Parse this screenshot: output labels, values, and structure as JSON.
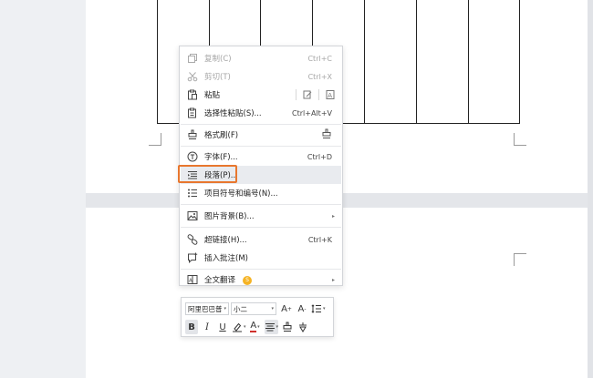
{
  "context_menu": {
    "items": [
      {
        "label": "复制(C)",
        "shortcut": "Ctrl+C",
        "icon": "copy-icon",
        "disabled": true
      },
      {
        "label": "剪切(T)",
        "shortcut": "Ctrl+X",
        "icon": "scissors-icon",
        "disabled": true
      },
      {
        "label": "粘贴",
        "shortcut": "",
        "icon": "paste-icon",
        "disabled": false
      },
      {
        "label": "选择性粘贴(S)...",
        "shortcut": "Ctrl+Alt+V",
        "icon": "paste-special-icon",
        "disabled": false
      },
      {
        "label": "格式刷(F)",
        "shortcut": "",
        "icon": "format-painter-icon",
        "disabled": false
      },
      {
        "label": "字体(F)...",
        "shortcut": "Ctrl+D",
        "icon": "font-icon",
        "disabled": false
      },
      {
        "label": "段落(P)...",
        "shortcut": "",
        "icon": "paragraph-icon",
        "disabled": false
      },
      {
        "label": "项目符号和编号(N)...",
        "shortcut": "",
        "icon": "bullet-list-icon",
        "disabled": false
      },
      {
        "label": "图片背景(B)...",
        "shortcut": "",
        "icon": "picture-icon",
        "disabled": false
      },
      {
        "label": "超链接(H)...",
        "shortcut": "Ctrl+K",
        "icon": "link-icon",
        "disabled": false
      },
      {
        "label": "插入批注(M)",
        "shortcut": "",
        "icon": "comment-icon",
        "disabled": false
      },
      {
        "label": "全文翻译",
        "shortcut": "",
        "icon": "translate-icon",
        "disabled": false
      }
    ],
    "highlight_color": "#e8772e"
  },
  "mini_toolbar": {
    "font_name": "阿里巴巴普",
    "font_size": "小二",
    "grow_font": "A",
    "shrink_font": "A",
    "bold": "B",
    "italic": "I",
    "underline": "U",
    "font_color": "A"
  }
}
